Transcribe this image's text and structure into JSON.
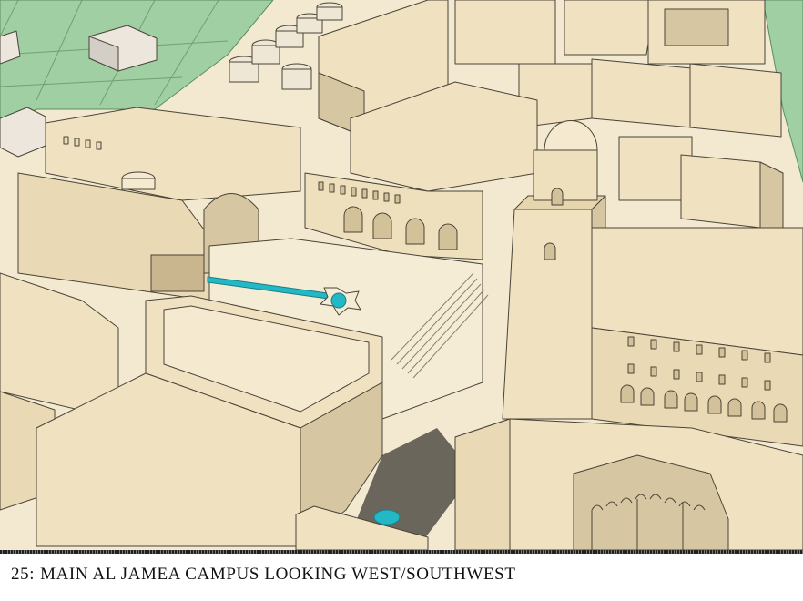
{
  "figure": {
    "number": "25:",
    "caption": "MAIN AL JAMEA CAMPUS LOOKING WEST/SOUTHWEST"
  },
  "colors": {
    "building": "#f0e2c0",
    "building_shade": "#d6c6a2",
    "ground": "#f3e9d0",
    "lawn": "#9fcfa3",
    "water": "#22b8c4",
    "outline": "#4a4438"
  }
}
